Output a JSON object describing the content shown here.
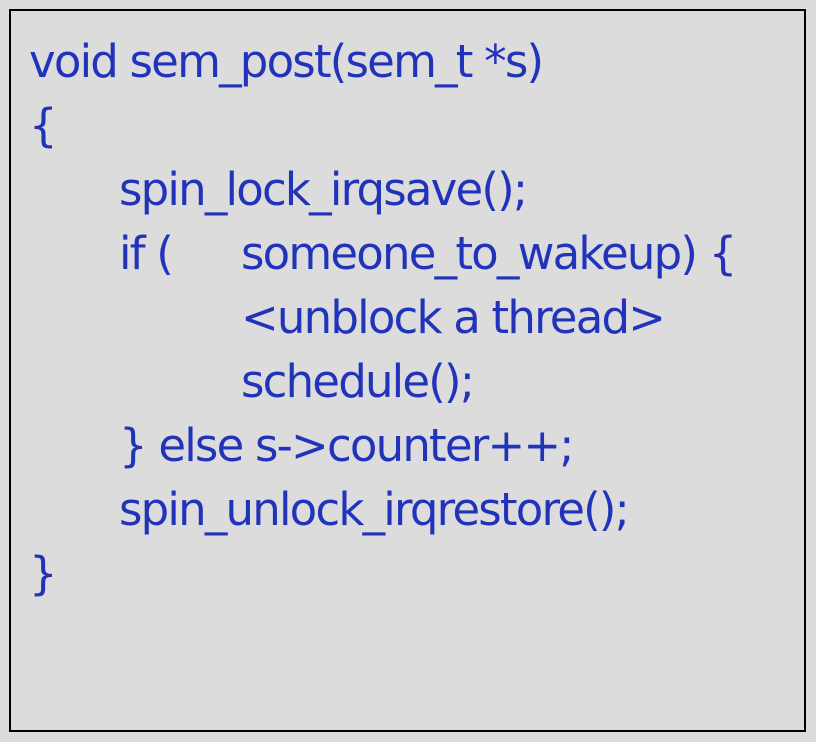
{
  "code_block": {
    "lines": [
      "void sem_post(sem_t *s)",
      "{",
      "spin_lock_irqsave();",
      "if (",
      "someone_to_wakeup) {",
      "<unblock a thread>",
      "schedule();",
      "} else s->counter++;",
      "spin_unlock_irqrestore();",
      "}"
    ]
  },
  "colors": {
    "background": "#dcdcdc",
    "border": "#000000",
    "code_text": "#2233bb"
  }
}
